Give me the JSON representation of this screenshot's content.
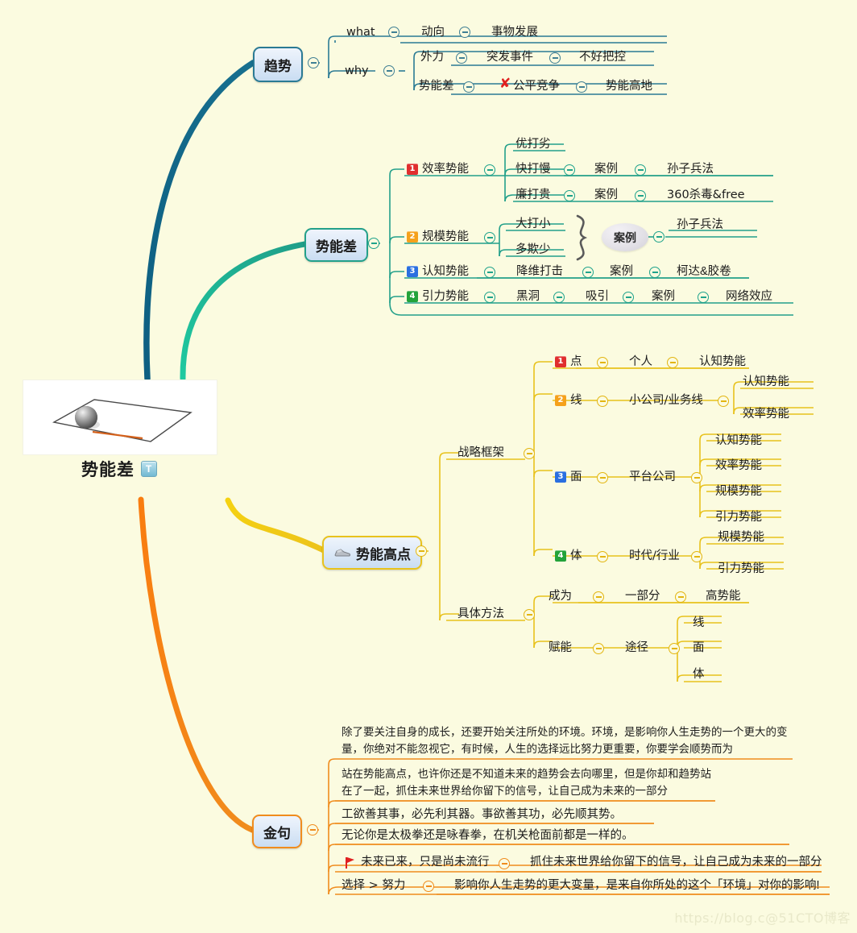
{
  "meta": {
    "watermark": "https://blog.c@51CTO博客",
    "bg_color": "#fbfbe0"
  },
  "root": {
    "title": "势能差",
    "badge": "T",
    "image_alt": "ball-on-inclined-plane"
  },
  "branches": [
    {
      "id": "trend",
      "label": "趋势",
      "color": "#2a7a94",
      "children": [
        {
          "label": "what",
          "children": [
            {
              "label": "动向",
              "children": [
                {
                  "label": "事物发展"
                }
              ]
            }
          ]
        },
        {
          "label": "why",
          "children": [
            {
              "label": "外力",
              "children": [
                {
                  "label": "突发事件",
                  "children": [
                    {
                      "label": "不好把控"
                    }
                  ]
                }
              ]
            },
            {
              "label": "势能差",
              "children": [
                {
                  "label": "公平竞争",
                  "mark": "x",
                  "children": [
                    {
                      "label": "势能高地"
                    }
                  ]
                }
              ]
            }
          ]
        }
      ]
    },
    {
      "id": "potential-diff",
      "label": "势能差",
      "color": "#23a08a",
      "children": [
        {
          "num": "1",
          "num_color": "#e02e2e",
          "label": "效率势能",
          "children": [
            {
              "label": "优打劣"
            },
            {
              "label": "快打慢",
              "children": [
                {
                  "label": "案例",
                  "children": [
                    {
                      "label": "孙子兵法"
                    }
                  ]
                }
              ]
            },
            {
              "label": "廉打贵",
              "children": [
                {
                  "label": "案例",
                  "children": [
                    {
                      "label": "360杀毒&free"
                    }
                  ]
                }
              ]
            }
          ]
        },
        {
          "num": "2",
          "num_color": "#f5a11b",
          "label": "规模势能",
          "children": [
            {
              "label": "大打小"
            },
            {
              "label": "多欺少"
            },
            {
              "label": "案例",
              "shape": "ellipse",
              "children": [
                {
                  "label": "孙子兵法"
                }
              ]
            }
          ]
        },
        {
          "num": "3",
          "num_color": "#2a6fe0",
          "label": "认知势能",
          "children": [
            {
              "label": "降维打击",
              "children": [
                {
                  "label": "案例",
                  "children": [
                    {
                      "label": "柯达&胶卷"
                    }
                  ]
                }
              ]
            }
          ]
        },
        {
          "num": "4",
          "num_color": "#23a33a",
          "label": "引力势能",
          "children": [
            {
              "label": "黑洞",
              "children": [
                {
                  "label": "吸引",
                  "children": [
                    {
                      "label": "案例",
                      "children": [
                        {
                          "label": "网络效应"
                        }
                      ]
                    }
                  ]
                }
              ]
            }
          ]
        }
      ]
    },
    {
      "id": "high-point",
      "label": "势能高点",
      "icon": "sneaker-icon",
      "color": "#e8c21c",
      "children": [
        {
          "label": "战略框架",
          "children": [
            {
              "num": "1",
              "num_color": "#e02e2e",
              "label": "点",
              "children": [
                {
                  "label": "个人",
                  "children": [
                    {
                      "label": "认知势能"
                    }
                  ]
                }
              ]
            },
            {
              "num": "2",
              "num_color": "#f5a11b",
              "label": "线",
              "children": [
                {
                  "label": "小公司/业务线",
                  "children": [
                    {
                      "label": "认知势能"
                    },
                    {
                      "label": "效率势能"
                    }
                  ]
                }
              ]
            },
            {
              "num": "3",
              "num_color": "#2a6fe0",
              "label": "面",
              "children": [
                {
                  "label": "平台公司",
                  "children": [
                    {
                      "label": "认知势能"
                    },
                    {
                      "label": "效率势能"
                    },
                    {
                      "label": "规模势能"
                    },
                    {
                      "label": "引力势能"
                    }
                  ]
                }
              ]
            },
            {
              "num": "4",
              "num_color": "#23a33a",
              "label": "体",
              "children": [
                {
                  "label": "时代/行业",
                  "children": [
                    {
                      "label": "规模势能"
                    },
                    {
                      "label": "引力势能"
                    }
                  ]
                }
              ]
            }
          ]
        },
        {
          "label": "具体方法",
          "children": [
            {
              "label": "成为",
              "children": [
                {
                  "label": "一部分",
                  "children": [
                    {
                      "label": "高势能"
                    }
                  ]
                }
              ]
            },
            {
              "label": "赋能",
              "children": [
                {
                  "label": "途径",
                  "children": [
                    {
                      "label": "线"
                    },
                    {
                      "label": "面"
                    },
                    {
                      "label": "体"
                    }
                  ]
                }
              ]
            }
          ]
        }
      ]
    },
    {
      "id": "golden-sentences",
      "label": "金句",
      "color": "#f08c1d",
      "children": [
        {
          "label": "除了要关注自身的成长，还要开始关注所处的环境。环境，是影响你人生走势的一个更大的变量，你绝对不能忽视它，有时候，人生的选择远比努力更重要，你要学会顺势而为"
        },
        {
          "label": "站在势能高点，也许你还是不知道未来的趋势会去向哪里，但是你却和趋势站在了一起，抓住未来世界给你留下的信号，让自己成为未来的一部分"
        },
        {
          "label": "工欲善其事，必先利其器。事欲善其功，必先顺其势。"
        },
        {
          "label": "无论你是太极拳还是咏春拳，在机关枪面前都是一样的。"
        },
        {
          "label": "未来已来，只是尚未流行",
          "mark": "flag",
          "children": [
            {
              "label": "抓住未来世界给你留下的信号，让自己成为未来的一部分"
            }
          ]
        },
        {
          "label": "选择 > 努力",
          "children": [
            {
              "label": "影响你人生走势的更大变量，是来自你所处的这个「环境」对你的影响!"
            }
          ]
        }
      ]
    }
  ]
}
